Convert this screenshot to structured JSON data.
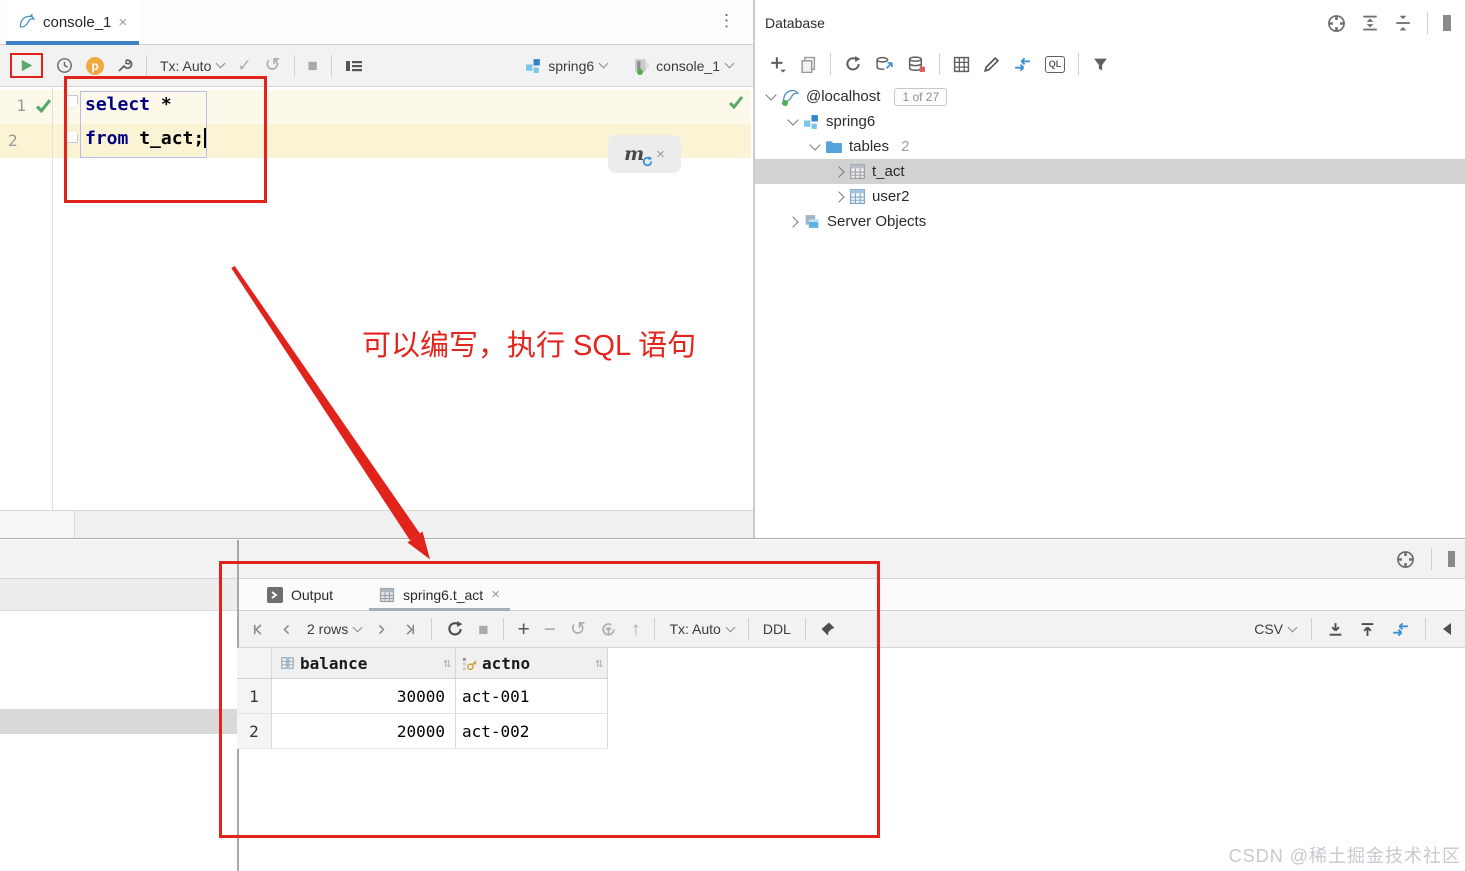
{
  "left_panel": {
    "tab": {
      "title": "console_1"
    },
    "toolbar": {
      "tx_label": "Tx: Auto",
      "schema_selector": "spring6",
      "session_selector": "console_1"
    },
    "editor": {
      "lines": [
        {
          "num": "1",
          "keyword": "select",
          "rest": " *"
        },
        {
          "num": "2",
          "keyword": "from",
          "rest": " t_act;"
        }
      ],
      "popup_label": "m"
    }
  },
  "database_panel": {
    "title": "Database",
    "tree": [
      {
        "label": "@localhost",
        "badge": "1 of 27"
      },
      {
        "label": "spring6"
      },
      {
        "label": "tables",
        "count": "2"
      },
      {
        "label": "t_act"
      },
      {
        "label": "user2"
      },
      {
        "label": "Server Objects"
      }
    ]
  },
  "results_panel": {
    "tabs": {
      "output": "Output",
      "result": "spring6.t_act"
    },
    "toolbar": {
      "rows_count": "2 rows",
      "tx_label": "Tx: Auto",
      "ddl_label": "DDL",
      "csv_label": "CSV"
    },
    "grid": {
      "columns": [
        "balance",
        "actno"
      ],
      "rows": [
        {
          "num": "1",
          "balance": "30000",
          "actno": "act-001"
        },
        {
          "num": "2",
          "balance": "20000",
          "actno": "act-002"
        }
      ]
    }
  },
  "annotations": {
    "note": "可以编写，执行 SQL 语句"
  },
  "watermark": "CSDN @稀土掘金技术社区",
  "colors": {
    "annotation_red": "#E0241C",
    "tab_accent": "#3F83C9",
    "selection_gray": "#D2D2D2",
    "exec_green": "#59A869"
  },
  "icons": {
    "close": "×",
    "kebab": "⋮",
    "check": "✓",
    "undo": "↺",
    "stop": "■",
    "plus": "+",
    "minus": "−",
    "up": "↑",
    "sort": "⇅",
    "p_badge": "p",
    "ql_label": "QL"
  }
}
